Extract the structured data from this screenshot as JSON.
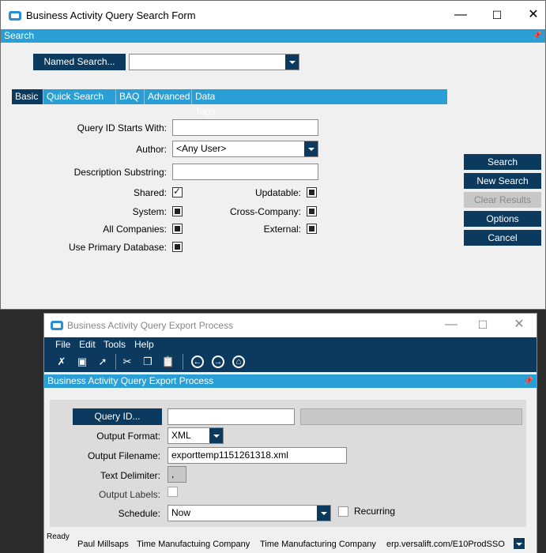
{
  "search_window": {
    "title": "Business Activity Query Search Form",
    "section_label": "Search",
    "named_search_button": "Named Search...",
    "named_search_value": "",
    "tabs": [
      "Basic",
      "Quick Search",
      "BAQ",
      "Advanced",
      "Data Tags"
    ],
    "active_tab": "Basic",
    "query_id_label": "Query ID Starts With:",
    "query_id_value": "",
    "author_label": "Author:",
    "author_value": "<Any User>",
    "description_label": "Description Substring:",
    "description_value": "",
    "shared_label": "Shared:",
    "shared_checked": true,
    "updatable_label": "Updatable:",
    "system_label": "System:",
    "cross_company_label": "Cross-Company:",
    "all_companies_label": "All Companies:",
    "external_label": "External:",
    "use_primary_db_label": "Use Primary Database:",
    "buttons": {
      "search": "Search",
      "new_search": "New Search",
      "clear_results": "Clear Results",
      "options": "Options",
      "cancel": "Cancel"
    }
  },
  "export_window": {
    "title": "Business Activity Query Export Process",
    "menu": [
      "File",
      "Edit",
      "Tools",
      "Help"
    ],
    "section_label": "Business Activity Query Export Process",
    "query_id_button": "Query ID...",
    "query_id_value": "",
    "output_format_label": "Output Format:",
    "output_format_value": "XML",
    "output_filename_label": "Output Filename:",
    "output_filename_value": "exporttemp1151261318.xml",
    "text_delimiter_label": "Text Delimiter:",
    "text_delimiter_value": ",",
    "output_labels_label": "Output Labels:",
    "schedule_label": "Schedule:",
    "schedule_value": "Now",
    "recurring_label": "Recurring",
    "status": {
      "ready": "Ready",
      "user": "Paul Millsaps",
      "company1": "Time Manufactuing Company",
      "company2": "Time Manufacturing Company",
      "server": "erp.versalift.com/E10ProdSSO"
    }
  },
  "colors": {
    "accent_blue": "#2a9fd6",
    "navy": "#0c3a5e",
    "window_bg": "#f0f0f0"
  }
}
